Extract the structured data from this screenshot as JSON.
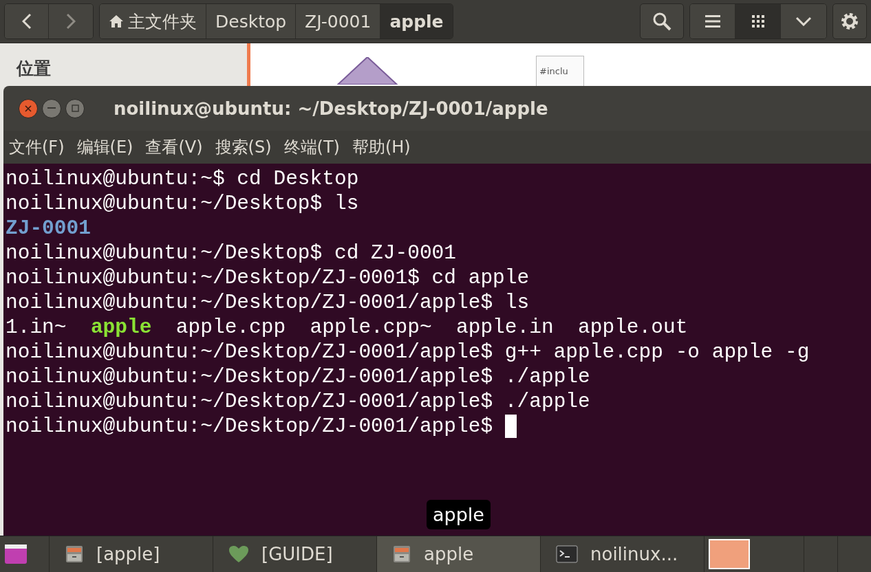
{
  "toolbar": {
    "crumbs": [
      {
        "label": "主文件夹",
        "kind": "home",
        "selected": false
      },
      {
        "label": "Desktop",
        "kind": "plain",
        "selected": false
      },
      {
        "label": "ZJ-0001",
        "kind": "plain",
        "selected": false
      },
      {
        "label": "apple",
        "kind": "plain",
        "selected": true
      }
    ],
    "views": [
      {
        "kind": "list",
        "selected": false
      },
      {
        "kind": "grid",
        "selected": true
      },
      {
        "kind": "more",
        "selected": false
      }
    ]
  },
  "sidebar": {
    "heading": "位置"
  },
  "files": [
    {
      "kind": "exec"
    },
    {
      "kind": "text",
      "preview": "#inclu"
    }
  ],
  "terminal": {
    "title": "noilinux@ubuntu: ~/Desktop/ZJ-0001/apple",
    "menu": [
      "文件(F)",
      "编辑(E)",
      "查看(V)",
      "搜索(S)",
      "终端(T)",
      "帮助(H)"
    ],
    "lines": [
      [
        {
          "kind": "plain",
          "text": "noilinux@ubuntu:~$ cd Desktop"
        }
      ],
      [
        {
          "kind": "plain",
          "text": "noilinux@ubuntu:~/Desktop$ ls"
        }
      ],
      [
        {
          "kind": "dir",
          "text": "ZJ-0001"
        }
      ],
      [
        {
          "kind": "plain",
          "text": "noilinux@ubuntu:~/Desktop$ cd ZJ-0001"
        }
      ],
      [
        {
          "kind": "plain",
          "text": "noilinux@ubuntu:~/Desktop/ZJ-0001$ cd apple"
        }
      ],
      [
        {
          "kind": "plain",
          "text": "noilinux@ubuntu:~/Desktop/ZJ-0001/apple$ ls"
        }
      ],
      [
        {
          "kind": "plain",
          "text": "1.in~  "
        },
        {
          "kind": "exec",
          "text": "apple"
        },
        {
          "kind": "plain",
          "text": "  apple.cpp  apple.cpp~  apple.in  apple.out"
        }
      ],
      [
        {
          "kind": "plain",
          "text": "noilinux@ubuntu:~/Desktop/ZJ-0001/apple$ g++ apple.cpp -o apple -g"
        }
      ],
      [
        {
          "kind": "plain",
          "text": "noilinux@ubuntu:~/Desktop/ZJ-0001/apple$ ./apple"
        }
      ],
      [
        {
          "kind": "plain",
          "text": "noilinux@ubuntu:~/Desktop/ZJ-0001/apple$ ./apple"
        }
      ],
      [
        {
          "kind": "plain",
          "text": "noilinux@ubuntu:~/Desktop/ZJ-0001/apple$ "
        },
        {
          "kind": "cursor"
        }
      ]
    ],
    "tooltip": "apple"
  },
  "taskbar": [
    {
      "kind": "cabinet",
      "label": "[apple]",
      "selected": false
    },
    {
      "kind": "heart",
      "label": "[GUIDE]",
      "selected": false
    },
    {
      "kind": "cabinet",
      "label": "apple",
      "selected": true
    },
    {
      "kind": "terminal",
      "label": "noilinux...",
      "selected": false
    }
  ]
}
